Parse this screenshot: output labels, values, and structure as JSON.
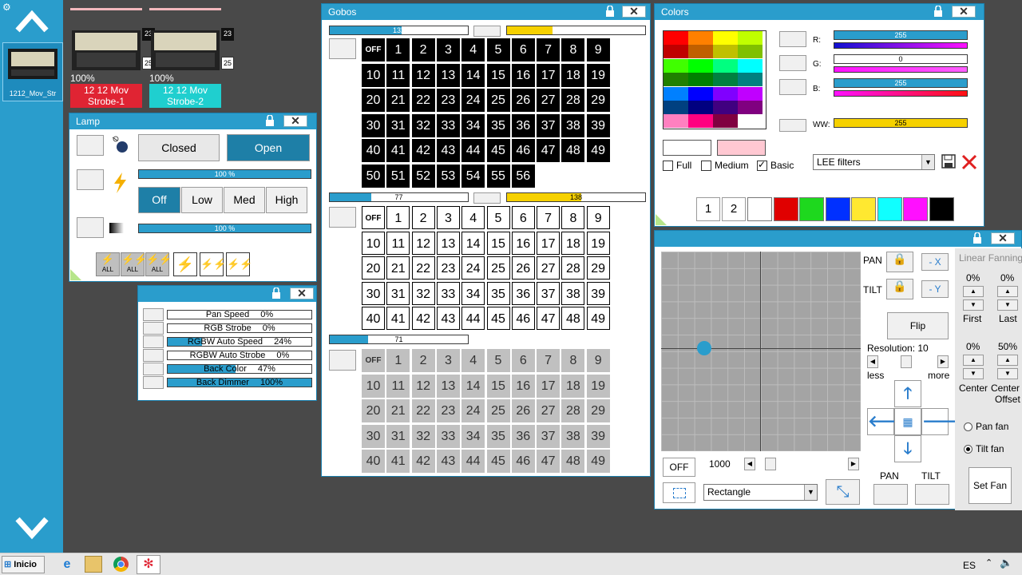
{
  "left_bar": {
    "selected_fixture_label": "1212_Mov_Str"
  },
  "fixtures": [
    {
      "num_top": "23",
      "num_bottom": "25",
      "percent": "100%",
      "label": "12 12 Mov Strobe-1",
      "color": "#e02433"
    },
    {
      "num_top": "23",
      "num_bottom": "25",
      "percent": "100%",
      "label": "12 12 Mov Strobe-2",
      "color": "#1fcfcf"
    }
  ],
  "lamp": {
    "title": "Lamp",
    "closed_label": "Closed",
    "open_label": "Open",
    "bar1": {
      "text": "100 %",
      "fill": 1.0
    },
    "bar2": {
      "text": "100 %",
      "fill": 1.0
    },
    "speed_buttons": [
      "Off",
      "Low",
      "Med",
      "High"
    ],
    "strobe_labels": [
      "ALL",
      "ALL",
      "ALL"
    ]
  },
  "params": {
    "rows": [
      {
        "label": "Pan Speed",
        "value": "0%",
        "fill": 0.0
      },
      {
        "label": "RGB Strobe",
        "value": "0%",
        "fill": 0.0
      },
      {
        "label": "RGBW Auto Speed",
        "value": "24%",
        "fill": 0.24
      },
      {
        "label": "RGBW Auto Strobe",
        "value": "0%",
        "fill": 0.0
      },
      {
        "label": "Back Color",
        "value": "47%",
        "fill": 0.47
      },
      {
        "label": "Back Dimmer",
        "value": "100%",
        "fill": 1.0
      }
    ]
  },
  "gobos": {
    "title": "Gobos",
    "section1": {
      "bar": "132",
      "bar_fill": 0.52,
      "yellow_fill": 0.33,
      "yellow_text": "",
      "cells": [
        "OFF",
        "1",
        "2",
        "3",
        "4",
        "5",
        "6",
        "7",
        "8",
        "9",
        "10",
        "11",
        "12",
        "13",
        "14",
        "15",
        "16",
        "17",
        "18",
        "19",
        "20",
        "21",
        "22",
        "23",
        "24",
        "25",
        "26",
        "27",
        "28",
        "29",
        "30",
        "31",
        "32",
        "33",
        "34",
        "35",
        "36",
        "37",
        "38",
        "39",
        "40",
        "41",
        "42",
        "43",
        "44",
        "45",
        "46",
        "47",
        "48",
        "49",
        "50",
        "51",
        "52",
        "53",
        "54",
        "55",
        "56"
      ]
    },
    "section2": {
      "bar": "77",
      "bar_fill": 0.3,
      "yellow_fill": 0.54,
      "yellow_text": "138",
      "cells": [
        "OFF",
        "1",
        "2",
        "3",
        "4",
        "5",
        "6",
        "7",
        "8",
        "9",
        "10",
        "11",
        "12",
        "13",
        "14",
        "15",
        "16",
        "17",
        "18",
        "19",
        "20",
        "21",
        "22",
        "23",
        "24",
        "25",
        "26",
        "27",
        "28",
        "29",
        "30",
        "31",
        "32",
        "33",
        "34",
        "35",
        "36",
        "37",
        "38",
        "39",
        "40",
        "41",
        "42",
        "43",
        "44",
        "45",
        "46",
        "47",
        "48",
        "49"
      ]
    },
    "section3": {
      "bar": "71",
      "bar_fill": 0.28,
      "cells": [
        "OFF",
        "1",
        "2",
        "3",
        "4",
        "5",
        "6",
        "7",
        "8",
        "9",
        "10",
        "11",
        "12",
        "13",
        "14",
        "15",
        "16",
        "17",
        "18",
        "19",
        "20",
        "21",
        "22",
        "23",
        "24",
        "25",
        "26",
        "27",
        "28",
        "29",
        "30",
        "31",
        "32",
        "33",
        "34",
        "35",
        "36",
        "37",
        "38",
        "39",
        "40",
        "41",
        "42",
        "43",
        "44",
        "45",
        "46",
        "47",
        "48",
        "49"
      ]
    }
  },
  "colors": {
    "title": "Colors",
    "palette": [
      [
        "#ff0000",
        "#ff8000",
        "#ffff00",
        "#c0ff00"
      ],
      [
        "#c00000",
        "#c06000",
        "#c0c000",
        "#80c000"
      ],
      [
        "#40ff00",
        "#00ff00",
        "#00ff80",
        "#00ffff"
      ],
      [
        "#208000",
        "#008000",
        "#008040",
        "#008080"
      ],
      [
        "#0080ff",
        "#0000ff",
        "#8000ff",
        "#c000ff"
      ],
      [
        "#004080",
        "#000080",
        "#400080",
        "#800080"
      ],
      [
        "#ff80c0",
        "#ff0080",
        "#800040",
        "#ffffff"
      ]
    ],
    "r": {
      "label": "R:",
      "value": "255",
      "fill": 1.0
    },
    "g": {
      "label": "G:",
      "value": "0",
      "fill": 0.0
    },
    "b": {
      "label": "B:",
      "value": "255",
      "fill": 1.0
    },
    "ww": {
      "label": "WW:",
      "value": "255",
      "fill": 1.0
    },
    "checks": [
      {
        "label": "Full",
        "checked": false
      },
      {
        "label": "Medium",
        "checked": false
      },
      {
        "label": "Basic",
        "checked": true
      }
    ],
    "filter_select": "LEE filters",
    "presets": [
      "1",
      "2"
    ],
    "preset_swatches": [
      "#ffffff",
      "#e00000",
      "#1ed81e",
      "#0030ff",
      "#ffe830",
      "#10ffff",
      "#ff10ff",
      "#000000"
    ]
  },
  "pantilt": {
    "pan_label": "PAN",
    "tilt_label": "TILT",
    "neg_x": "- X",
    "neg_y": "- Y",
    "flip": "Flip",
    "resolution": "Resolution: 10",
    "less": "less",
    "more": "more",
    "off": "OFF",
    "speed_value": "1000",
    "shape_select": "Rectangle",
    "pan_bottom": "PAN",
    "tilt_bottom": "TILT",
    "fanning": {
      "header": "Linear Fanning",
      "first_val": "0%",
      "last_val": "0%",
      "first": "First",
      "last": "Last",
      "center_val": "0%",
      "offset_val": "50%",
      "center": "Center",
      "center_offset_1": "Center",
      "center_offset_2": "Offset",
      "pan_fan": "Pan fan",
      "tilt_fan": "Tilt fan",
      "set_fan": "Set Fan"
    }
  },
  "taskbar": {
    "start": "Inicio",
    "lang": "ES"
  }
}
